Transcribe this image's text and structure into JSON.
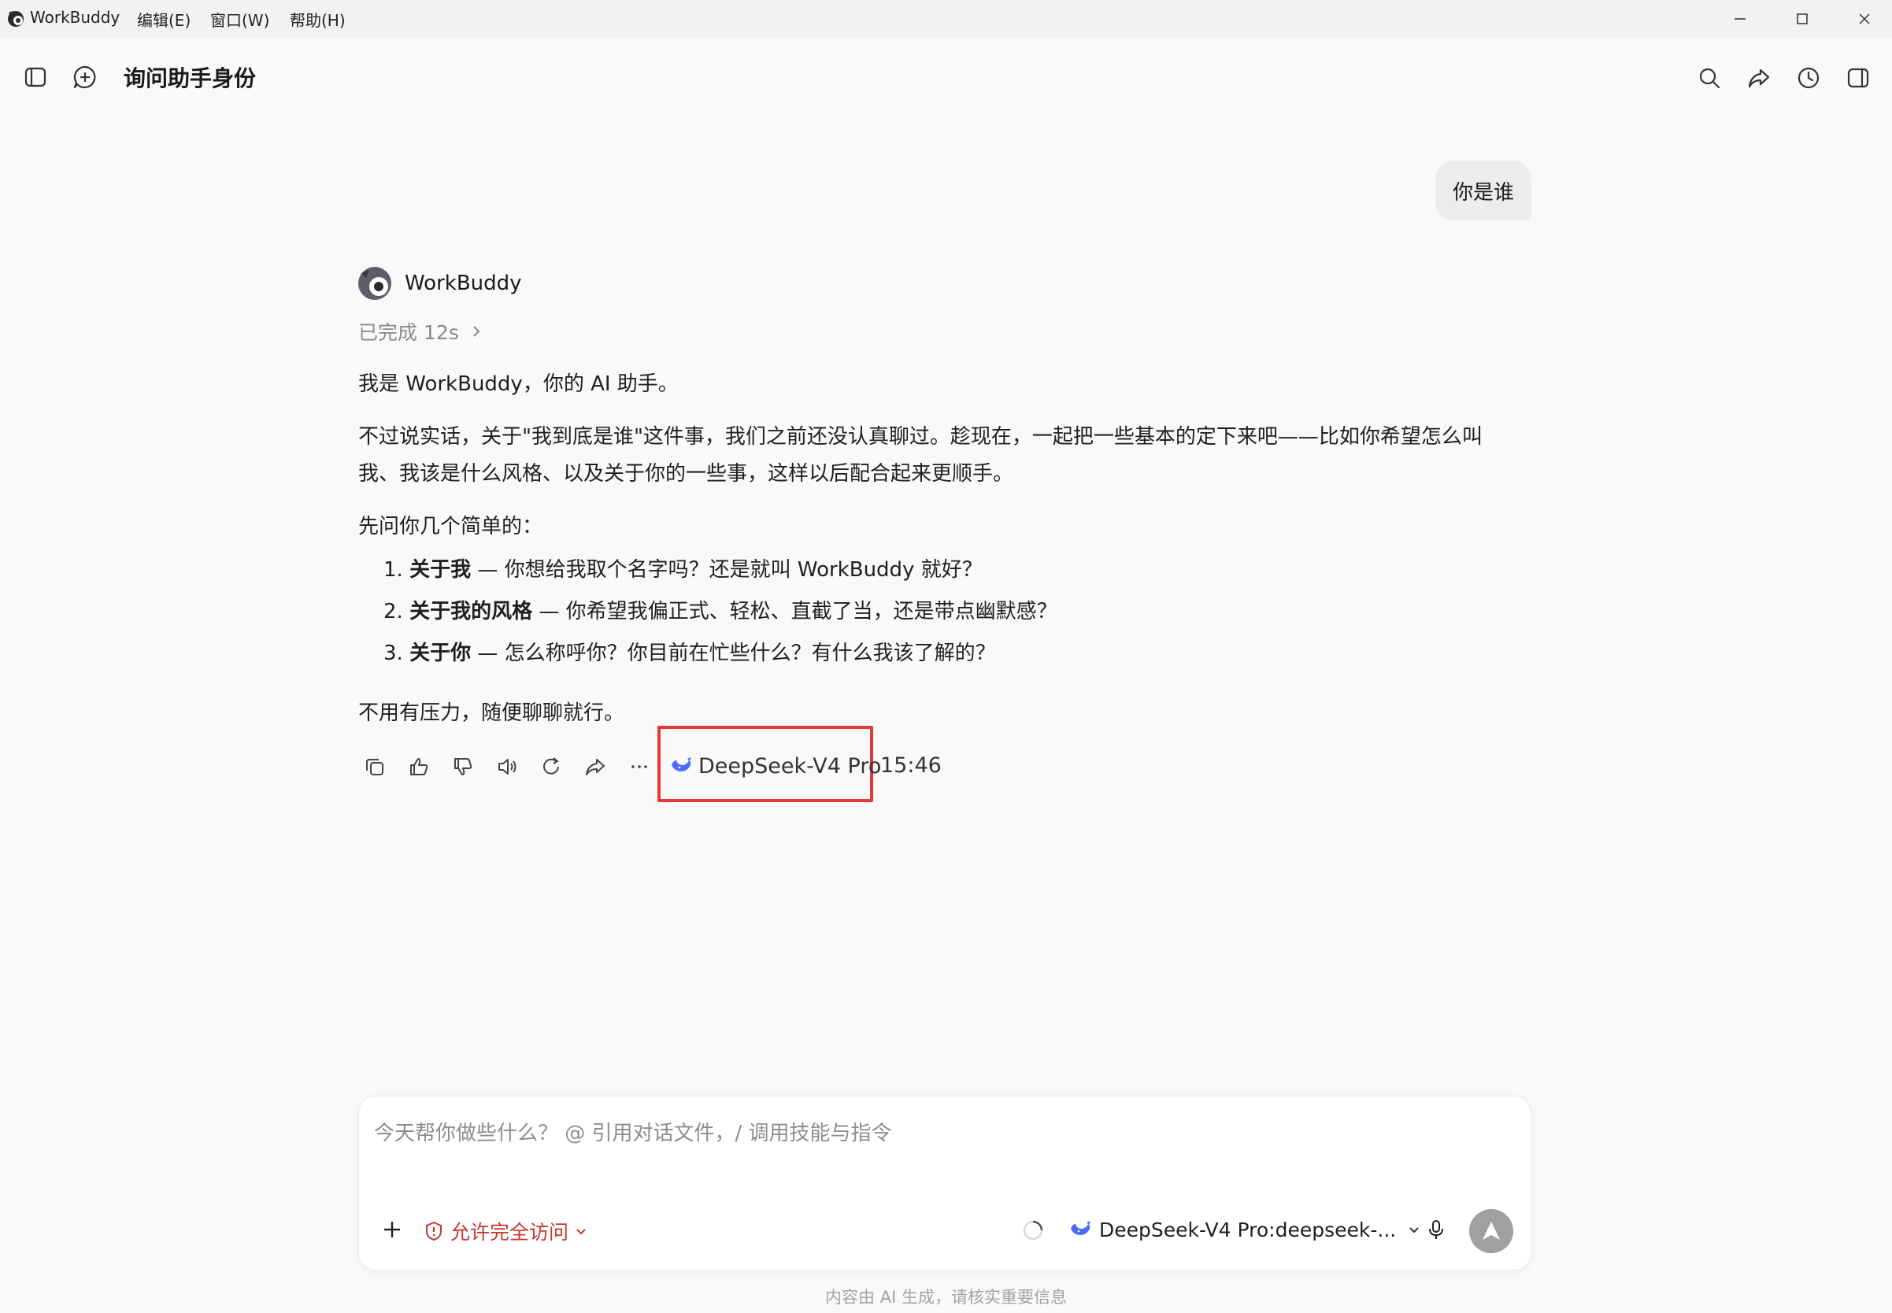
{
  "titlebar": {
    "app_name": "WorkBuddy",
    "menu": [
      "编辑(E)",
      "窗口(W)",
      "帮助(H)"
    ]
  },
  "header": {
    "title": "询问助手身份"
  },
  "conversation": {
    "user_message": "你是谁",
    "assistant": {
      "name": "WorkBuddy",
      "status": "已完成 12s",
      "paragraphs": [
        "我是 WorkBuddy，你的 AI 助手。",
        "不过说实话，关于\"我到底是谁\"这件事，我们之前还没认真聊过。趁现在，一起把一些基本的定下来吧——比如你希望怎么叫",
        "我、我该是什么风格、以及关于你的一些事，这样以后配合起来更顺手。",
        "先问你几个简单的："
      ],
      "list": [
        {
          "num": "1.",
          "bold": "关于我",
          "text": " — 你想给我取个名字吗？还是就叫 WorkBuddy 就好？"
        },
        {
          "num": "2.",
          "bold": "关于我的风格",
          "text": " — 你希望我偏正式、轻松、直截了当，还是带点幽默感？"
        },
        {
          "num": "3.",
          "bold": "关于你",
          "text": " — 怎么称呼你？你目前在忙些什么？有什么我该了解的？"
        }
      ],
      "closing": "不用有压力，随便聊聊就行。",
      "model": "DeepSeek-V4 Pro",
      "time": "15:46"
    }
  },
  "composer": {
    "placeholder": "今天帮你做些什么？ @ 引用对话文件，/ 调用技能与指令",
    "access_label": "允许完全访问",
    "model_select": "DeepSeek-V4 Pro:deepseek-...",
    "disclaimer": "内容由 AI 生成，请核实重要信息"
  },
  "colors": {
    "highlight": "#e53935",
    "access": "#c6382d",
    "deepseek_blue": "#4d6bfe"
  }
}
